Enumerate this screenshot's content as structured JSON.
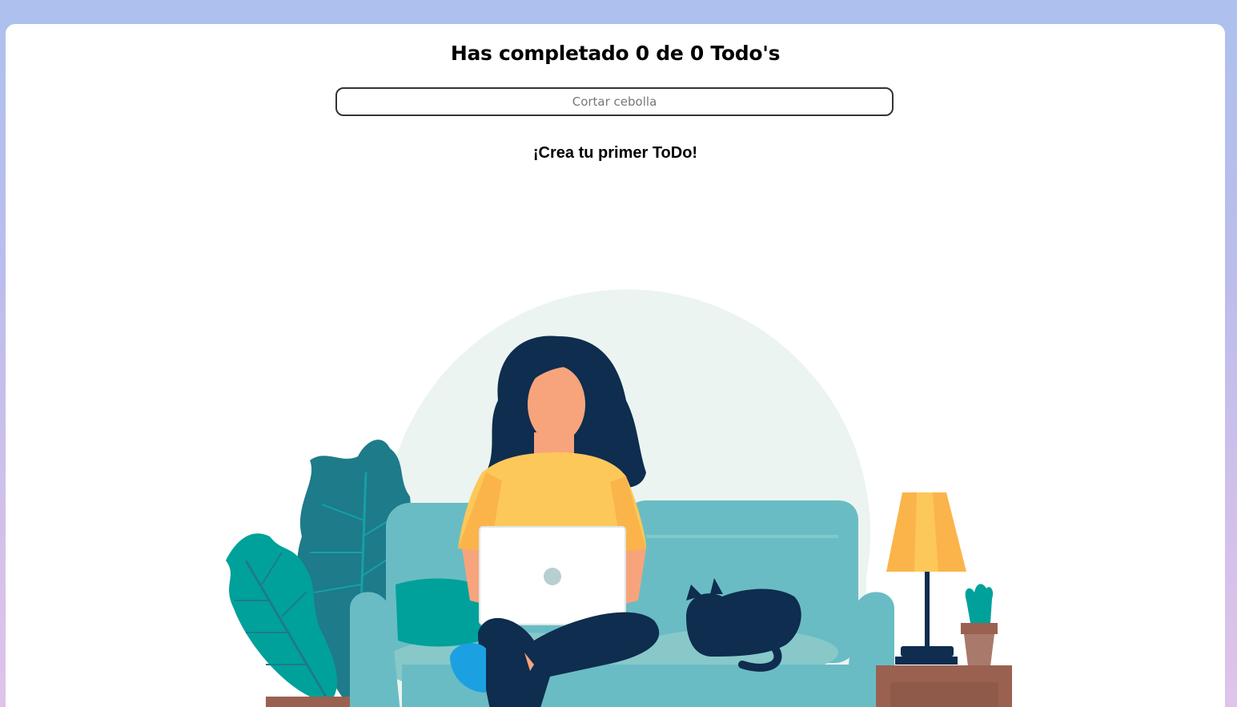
{
  "header": {
    "title": "Has completado 0 de 0 Todo's"
  },
  "search": {
    "placeholder": "Cortar cebolla",
    "value": ""
  },
  "empty_state": {
    "message": "¡Crea tu primer ToDo!"
  },
  "colors": {
    "background_top": "#adc1ee",
    "background_bottom": "#dfc3ea",
    "card": "#ffffff",
    "sofa": "#6abcc4",
    "hair": "#0e2d4f",
    "shirt": "#fdc85a",
    "plant": "#1d7b8a",
    "lamp": "#fbb44a"
  }
}
